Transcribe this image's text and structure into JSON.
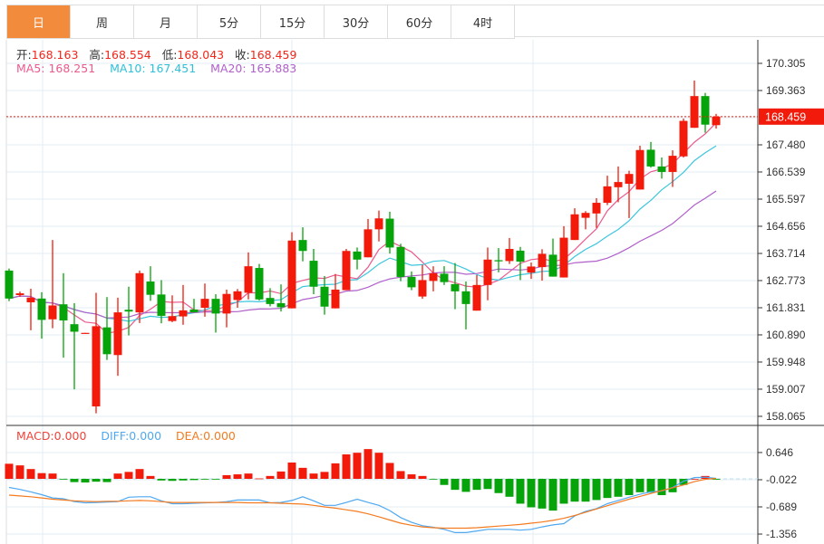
{
  "tabs": [
    {
      "label": "日",
      "active": true
    },
    {
      "label": "周",
      "active": false
    },
    {
      "label": "月",
      "active": false
    },
    {
      "label": "5分",
      "active": false
    },
    {
      "label": "15分",
      "active": false
    },
    {
      "label": "30分",
      "active": false
    },
    {
      "label": "60分",
      "active": false
    },
    {
      "label": "4时",
      "active": false
    }
  ],
  "ohlc": {
    "open_label": "开:",
    "open": "168.163",
    "high_label": "高:",
    "high": "168.554",
    "low_label": "低:",
    "low": "168.043",
    "close_label": "收:",
    "close": "168.459"
  },
  "ma": {
    "ma5": "MA5: 168.251",
    "ma10": "MA10: 167.451",
    "ma20": "MA20: 165.883"
  },
  "macd": {
    "macd": "MACD:0.000",
    "diff": "DIFF:0.000",
    "dea": "DEA:0.000"
  },
  "colors": {
    "up": "#f21a0a",
    "down": "#06a30b",
    "ma5": "#ea5a8e",
    "ma10": "#3cc6dd",
    "ma20": "#b160c9",
    "diff": "#4fa8f0",
    "dea": "#f47b20",
    "accent": "#f28b3c"
  },
  "chart_data": [
    {
      "type": "candlestick",
      "title": "",
      "current_price": 168.459,
      "ylim": [
        157.8,
        170.5
      ],
      "y_ticks": [
        "170.305",
        "169.363",
        "167.480",
        "166.539",
        "165.597",
        "164.656",
        "163.714",
        "162.773",
        "161.831",
        "160.890",
        "159.948",
        "159.007",
        "158.065"
      ],
      "candles": [
        [
          163.12,
          163.19,
          162.06,
          162.15
        ],
        [
          162.27,
          162.39,
          162.21,
          162.33
        ],
        [
          162.02,
          162.49,
          161.05,
          162.18
        ],
        [
          162.15,
          162.37,
          160.76,
          161.41
        ],
        [
          161.43,
          164.18,
          161.12,
          161.91
        ],
        [
          161.95,
          163.03,
          160.1,
          161.39
        ],
        [
          161.26,
          161.99,
          159.0,
          161.0
        ],
        [
          160.95,
          160.96,
          160.95,
          160.96
        ],
        [
          158.41,
          162.35,
          158.17,
          161.19
        ],
        [
          161.15,
          162.2,
          160.02,
          160.22
        ],
        [
          160.19,
          162.18,
          159.47,
          161.67
        ],
        [
          161.76,
          162.56,
          160.87,
          161.7
        ],
        [
          161.67,
          163.12,
          161.3,
          163.03
        ],
        [
          162.74,
          163.27,
          162.07,
          162.28
        ],
        [
          162.29,
          162.79,
          161.29,
          161.55
        ],
        [
          161.37,
          162.26,
          161.33,
          161.54
        ],
        [
          161.53,
          162.62,
          161.24,
          161.74
        ],
        [
          161.77,
          162.14,
          161.67,
          161.67
        ],
        [
          161.83,
          162.67,
          161.52,
          162.14
        ],
        [
          162.14,
          162.3,
          160.97,
          161.63
        ],
        [
          161.63,
          162.46,
          161.15,
          162.31
        ],
        [
          162.1,
          162.48,
          161.83,
          162.4
        ],
        [
          162.35,
          163.75,
          162.12,
          163.27
        ],
        [
          163.21,
          163.35,
          162.08,
          162.12
        ],
        [
          162.17,
          162.51,
          161.88,
          161.96
        ],
        [
          161.99,
          162.64,
          161.7,
          161.85
        ],
        [
          161.81,
          164.45,
          161.81,
          164.16
        ],
        [
          164.18,
          164.62,
          163.44,
          163.8
        ],
        [
          163.46,
          163.87,
          162.3,
          162.56
        ],
        [
          162.56,
          162.93,
          161.59,
          161.87
        ],
        [
          161.81,
          163.0,
          161.81,
          162.46
        ],
        [
          162.44,
          163.87,
          162.44,
          163.8
        ],
        [
          163.78,
          163.92,
          163.16,
          163.5
        ],
        [
          163.58,
          164.91,
          163.58,
          164.55
        ],
        [
          164.55,
          165.2,
          164.13,
          164.93
        ],
        [
          164.92,
          165.16,
          163.71,
          163.92
        ],
        [
          163.94,
          164.05,
          162.75,
          162.9
        ],
        [
          162.9,
          163.09,
          162.44,
          162.54
        ],
        [
          162.22,
          163.32,
          162.14,
          162.79
        ],
        [
          162.76,
          163.27,
          162.4,
          163.03
        ],
        [
          163.01,
          163.27,
          162.62,
          162.72
        ],
        [
          162.65,
          163.38,
          161.78,
          162.4
        ],
        [
          162.4,
          162.74,
          161.08,
          161.96
        ],
        [
          161.73,
          162.96,
          161.73,
          162.62
        ],
        [
          162.62,
          163.92,
          162.09,
          163.5
        ],
        [
          163.48,
          163.9,
          163.06,
          163.44
        ],
        [
          163.45,
          164.25,
          163.35,
          163.87
        ],
        [
          163.81,
          163.94,
          162.79,
          163.43
        ],
        [
          163.05,
          163.4,
          162.83,
          163.26
        ],
        [
          163.24,
          163.86,
          162.77,
          163.7
        ],
        [
          163.67,
          164.23,
          162.91,
          162.91
        ],
        [
          162.88,
          164.66,
          162.88,
          164.26
        ],
        [
          164.18,
          165.28,
          164.18,
          165.07
        ],
        [
          164.95,
          165.18,
          164.55,
          165.12
        ],
        [
          165.1,
          165.63,
          164.6,
          165.47
        ],
        [
          165.47,
          166.41,
          165.39,
          166.04
        ],
        [
          166.01,
          166.73,
          165.49,
          166.19
        ],
        [
          166.13,
          166.58,
          164.94,
          166.47
        ],
        [
          165.93,
          167.45,
          165.93,
          167.3
        ],
        [
          167.31,
          167.58,
          166.69,
          166.73
        ],
        [
          166.73,
          167.04,
          166.31,
          166.54
        ],
        [
          166.54,
          167.29,
          166.02,
          167.1
        ],
        [
          167.08,
          168.39,
          167.04,
          168.31
        ],
        [
          168.07,
          169.71,
          168.07,
          169.17
        ],
        [
          169.17,
          169.28,
          167.9,
          168.18
        ],
        [
          168.163,
          168.554,
          168.043,
          168.459
        ]
      ],
      "candle_fields": [
        "open",
        "high",
        "low",
        "close"
      ],
      "series": [
        {
          "name": "MA5",
          "period": 5
        },
        {
          "name": "MA10",
          "period": 10
        },
        {
          "name": "MA20",
          "period": 20
        }
      ]
    },
    {
      "type": "macd",
      "ylim": [
        -1.45,
        0.75
      ],
      "y_ticks": [
        "0.646",
        "-0.022",
        "-0.689",
        "-1.356"
      ],
      "histogram": [
        0.37,
        0.33,
        0.24,
        0.14,
        0.13,
        -0.01,
        -0.08,
        -0.09,
        -0.07,
        -0.08,
        0.13,
        0.17,
        0.24,
        0.07,
        -0.04,
        -0.05,
        -0.04,
        -0.03,
        -0.01,
        -0.01,
        0.09,
        0.11,
        0.13,
        0.01,
        0.07,
        0.18,
        0.4,
        0.27,
        0.13,
        0.17,
        0.38,
        0.6,
        0.64,
        0.73,
        0.64,
        0.39,
        0.19,
        0.11,
        0.07,
        -0.01,
        -0.15,
        -0.27,
        -0.32,
        -0.27,
        -0.25,
        -0.35,
        -0.44,
        -0.61,
        -0.7,
        -0.73,
        -0.78,
        -0.61,
        -0.56,
        -0.56,
        -0.52,
        -0.47,
        -0.44,
        -0.4,
        -0.33,
        -0.34,
        -0.4,
        -0.33,
        -0.15,
        0.0,
        0.07,
        -0.02
      ],
      "diff": [
        -0.21,
        -0.26,
        -0.32,
        -0.39,
        -0.47,
        -0.49,
        -0.56,
        -0.59,
        -0.58,
        -0.57,
        -0.56,
        -0.45,
        -0.44,
        -0.44,
        -0.54,
        -0.61,
        -0.61,
        -0.6,
        -0.59,
        -0.58,
        -0.56,
        -0.52,
        -0.52,
        -0.52,
        -0.59,
        -0.58,
        -0.53,
        -0.44,
        -0.54,
        -0.65,
        -0.65,
        -0.58,
        -0.5,
        -0.58,
        -0.65,
        -0.78,
        -0.95,
        -1.07,
        -1.15,
        -1.19,
        -1.24,
        -1.32,
        -1.32,
        -1.28,
        -1.24,
        -1.24,
        -1.24,
        -1.26,
        -1.24,
        -1.18,
        -1.13,
        -1.1,
        -0.91,
        -0.8,
        -0.73,
        -0.61,
        -0.53,
        -0.45,
        -0.38,
        -0.32,
        -0.3,
        -0.21,
        -0.06,
        0.03,
        0.04,
        0.01
      ],
      "dea": [
        -0.4,
        -0.42,
        -0.44,
        -0.47,
        -0.5,
        -0.52,
        -0.54,
        -0.55,
        -0.56,
        -0.55,
        -0.55,
        -0.54,
        -0.53,
        -0.54,
        -0.56,
        -0.58,
        -0.58,
        -0.58,
        -0.58,
        -0.58,
        -0.58,
        -0.58,
        -0.59,
        -0.59,
        -0.59,
        -0.6,
        -0.61,
        -0.62,
        -0.65,
        -0.69,
        -0.72,
        -0.76,
        -0.8,
        -0.86,
        -0.93,
        -1.01,
        -1.09,
        -1.14,
        -1.18,
        -1.2,
        -1.21,
        -1.21,
        -1.21,
        -1.2,
        -1.18,
        -1.16,
        -1.14,
        -1.12,
        -1.09,
        -1.06,
        -1.02,
        -0.97,
        -0.9,
        -0.82,
        -0.74,
        -0.66,
        -0.58,
        -0.5,
        -0.43,
        -0.36,
        -0.29,
        -0.22,
        -0.15,
        -0.07,
        -0.01,
        0.01
      ]
    }
  ]
}
